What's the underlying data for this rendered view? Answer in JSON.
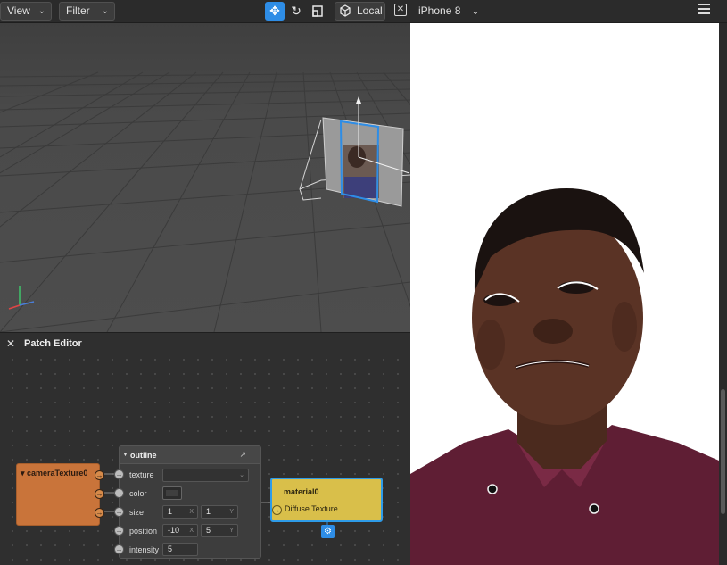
{
  "toolbar": {
    "view_label": "View",
    "filter_label": "Filter",
    "local_label": "Local",
    "device_label": "iPhone 8",
    "icons": {
      "move": "move-icon",
      "rotate": "rotate-icon",
      "scale": "scale-icon",
      "local": "cube-icon",
      "device": "device-icon",
      "menu": "hamburger-menu-icon"
    },
    "active_tool": "move",
    "accent_color": "#2e8de6"
  },
  "patch_editor": {
    "title": "Patch Editor",
    "nodes": {
      "camera_texture": {
        "title": "cameraTexture0",
        "color": "#c9743a"
      },
      "outline": {
        "title": "outline",
        "fields": {
          "texture": {
            "label": "texture"
          },
          "color": {
            "label": "color"
          },
          "size": {
            "label": "size",
            "x": "1",
            "y": "1"
          },
          "position": {
            "label": "position",
            "x": "-10",
            "y": "5"
          },
          "intensity": {
            "label": "intensity",
            "value": "5"
          }
        }
      },
      "material": {
        "title": "material0",
        "input": "Diffuse Texture",
        "color": "#d9bf4a"
      }
    }
  },
  "simulator": {
    "background": "#ffffff"
  }
}
